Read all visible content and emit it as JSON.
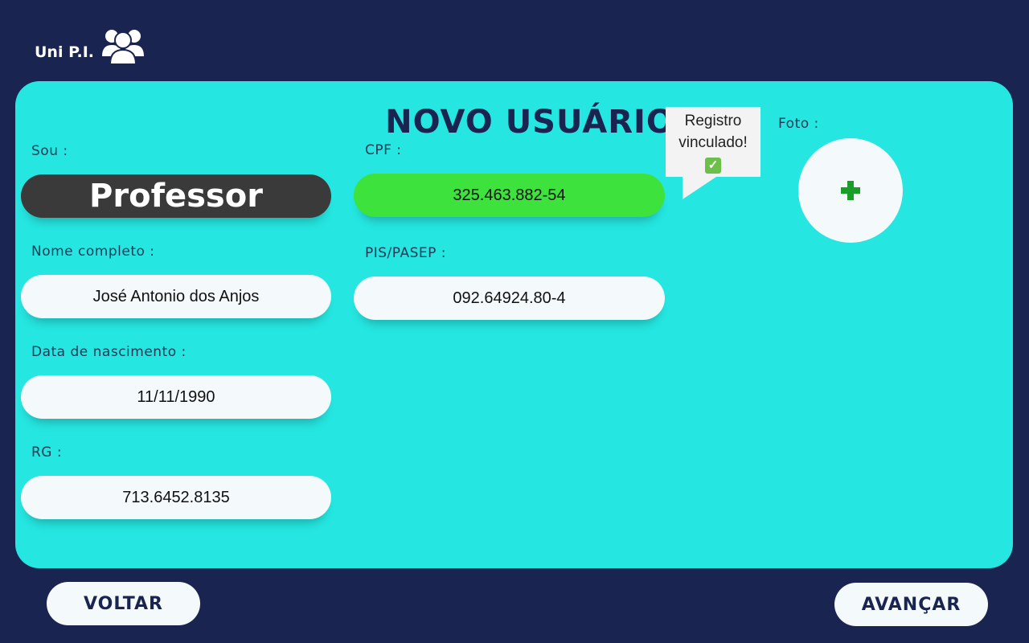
{
  "app": {
    "name": "Uni P.I.",
    "logo_icon": "users-icon"
  },
  "form": {
    "title": "NOVO USUÁRIO",
    "role_label": "Sou :",
    "role_value": "Professor",
    "name_label": "Nome completo :",
    "name_value": "José Antonio dos Anjos",
    "birth_label": "Data de nascimento :",
    "birth_value": "11/11/1990",
    "rg_label": "RG :",
    "rg_value": "713.6452.8135",
    "cpf_label": "CPF :",
    "cpf_value": "325.463.882-54",
    "pis_label": "PIS/PASEP :",
    "pis_value": "092.64924.80-4",
    "photo_label": "Foto :",
    "photo_add_icon": "plus-icon"
  },
  "tooltip": {
    "line1": "Registro",
    "line2": "vinculado!",
    "check": "✓"
  },
  "actions": {
    "back_label": "VOLTAR",
    "next_label": "AVANÇAR"
  },
  "colors": {
    "background": "#1a2450",
    "card": "#25e6e1",
    "cpf_valid": "#3de23c",
    "role_field": "#3a3a3a",
    "plus": "#1a9e2a"
  }
}
